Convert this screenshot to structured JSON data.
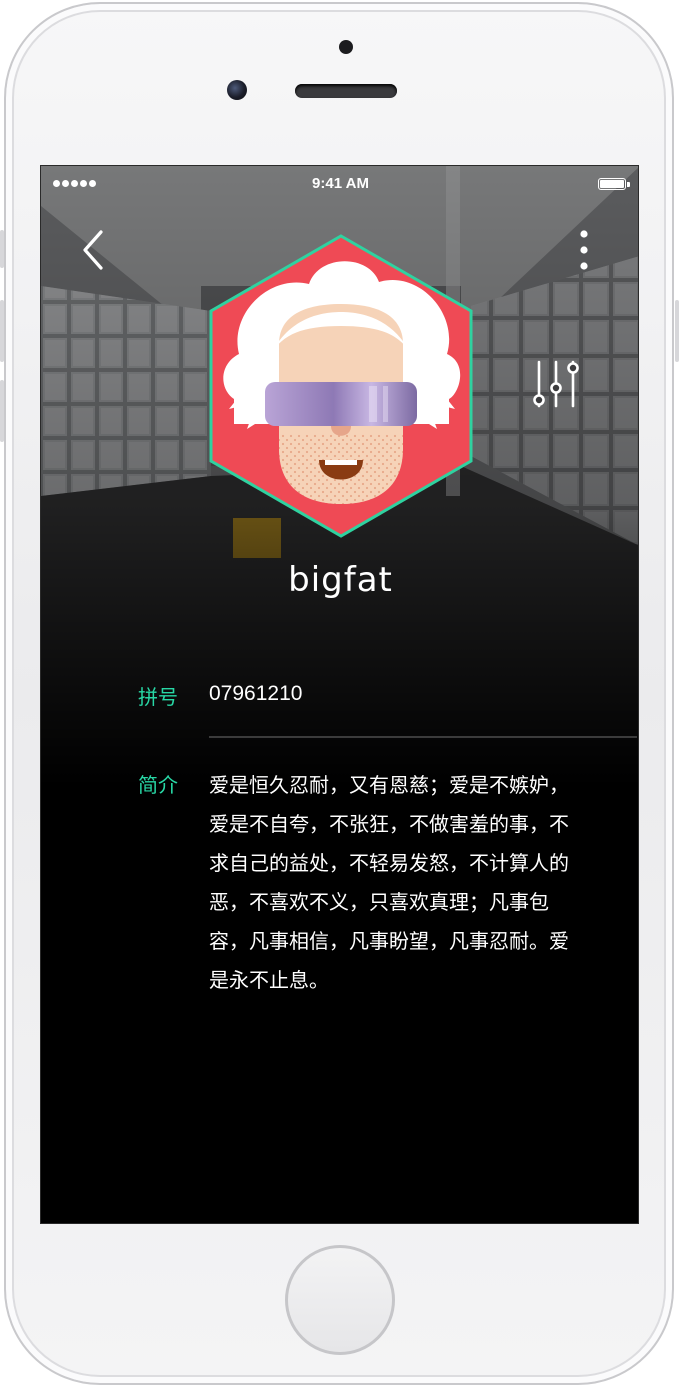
{
  "status_bar": {
    "time": "9:41 AM",
    "signal_dots": 5
  },
  "navigation": {
    "back_icon": "chevron-left-icon",
    "more_icon": "vertical-ellipsis-icon",
    "filter_icon": "sliders-icon"
  },
  "profile": {
    "username": "bigfat",
    "avatar_icon": "hexagon-avatar-icon",
    "fields": [
      {
        "label": "拼号",
        "value": "07961210"
      },
      {
        "label": "简介",
        "value": "爱是恒久忍耐，又有恩慈；爱是不嫉妒，爱是不自夸，不张狂，不做害羞的事，不求自己的益处，不轻易发怒，不计算人的恶，不喜欢不义，只喜欢真理；凡事包容，凡事相信，凡事盼望，凡事忍耐。爱是永不止息。"
      }
    ]
  },
  "colors": {
    "accent": "#28d7a5",
    "avatar_background": "#ef4a55",
    "hexagon_border": "#2fd2a0",
    "screen_background": "#000000",
    "text": "#ffffff"
  }
}
